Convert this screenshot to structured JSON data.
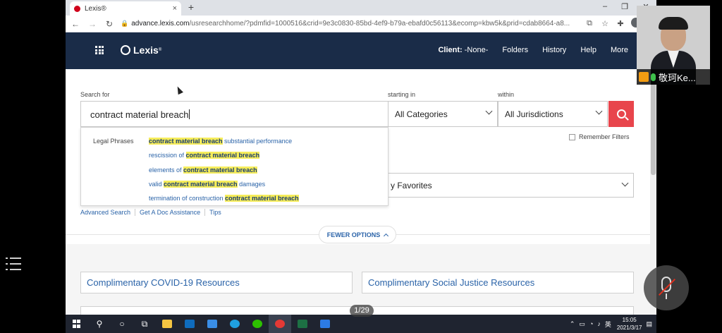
{
  "browser": {
    "tab_title": "Lexis®",
    "tab_close": "×",
    "new_tab": "+",
    "url_host": "advance.lexis.com",
    "url_path": "/usresearchhome/?pdmfid=1000516&crid=9e3c0830-85bd-4ef9-b79a-ebafd0c56113&ecomp=kbw5k&prid=cdab8664-a8...",
    "window_controls": [
      "–",
      "❐",
      "✕"
    ]
  },
  "header": {
    "logo_text": "Lexis",
    "logo_mark": "®",
    "client_label": "Client:",
    "client_value": "-None-",
    "nav": [
      "Folders",
      "History",
      "Help",
      "More"
    ]
  },
  "search": {
    "search_for_label": "Search for",
    "starting_in_label": "starting in",
    "within_label": "within",
    "query": "contract material breach",
    "category": "All Categories",
    "jurisdiction": "All Jurisdictions",
    "remember_filters": "Remember Filters",
    "favorites_partial": "y Favorites"
  },
  "suggestions": {
    "category": "Legal Phrases",
    "items": [
      {
        "pre": "",
        "hit": "contract material breach",
        "post": " substantial performance"
      },
      {
        "pre": "rescission of ",
        "hit": "contract material breach",
        "post": ""
      },
      {
        "pre": "elements of ",
        "hit": "contract material breach",
        "post": ""
      },
      {
        "pre": "valid ",
        "hit": "contract material breach",
        "post": " damages"
      },
      {
        "pre": "termination of construction ",
        "hit": "contract material breach",
        "post": ""
      }
    ]
  },
  "links": [
    "Advanced Search",
    "Get A Doc Assistance",
    "Tips"
  ],
  "fewer_options": "FEWER OPTIONS",
  "resources": [
    "Complimentary COVID-19 Resources",
    "Complimentary Social Justice Resources"
  ],
  "overlay": {
    "page_counter": "1/29",
    "video_name": "敬珂Ke..."
  },
  "taskbar": {
    "ime": "英",
    "time": "15:05",
    "date": "2021/3/17"
  },
  "colors": {
    "header_bg": "#1a2c48",
    "search_button": "#e8454c",
    "link": "#2a63a8",
    "highlight": "#f5ec5a"
  }
}
